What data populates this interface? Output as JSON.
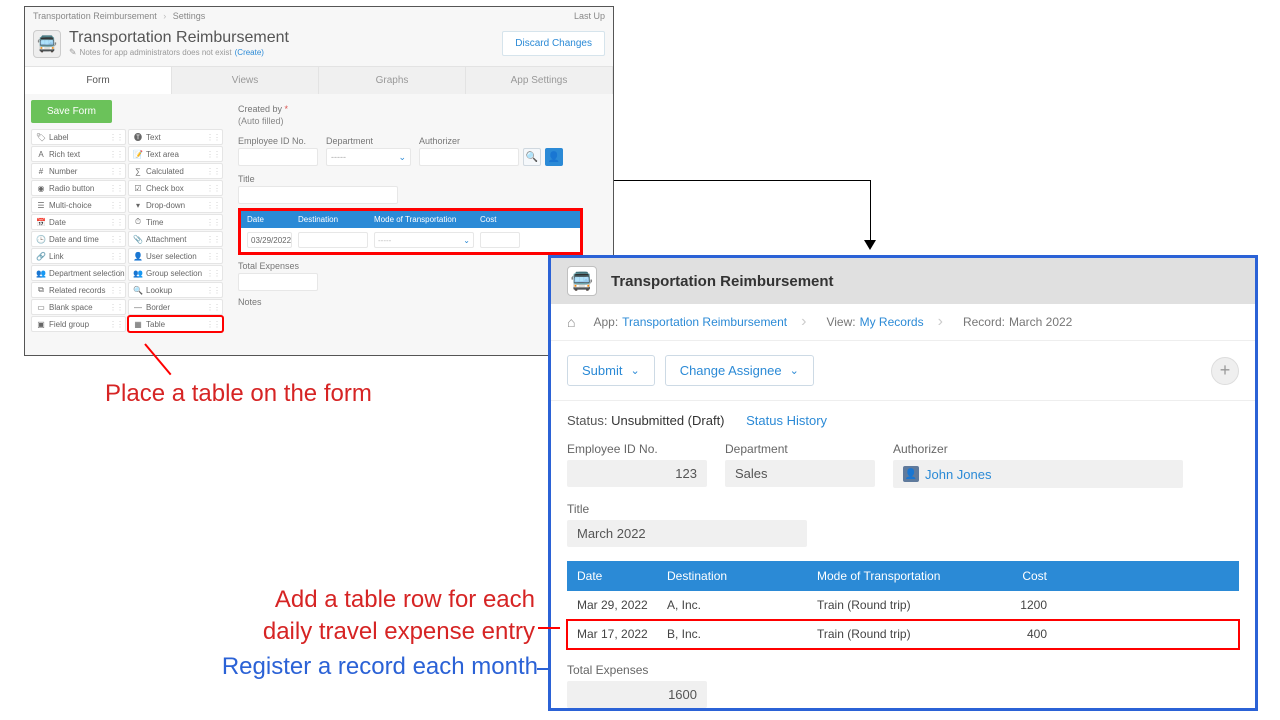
{
  "admin": {
    "breadcrumb": {
      "app": "Transportation Reimbursement",
      "page": "Settings",
      "lastup": "Last Up"
    },
    "title": "Transportation Reimbursement",
    "note_text": "Notes for app administrators does not exist",
    "note_link": "(Create)",
    "discard": "Discard Changes",
    "tabs": {
      "form": "Form",
      "views": "Views",
      "graphs": "Graphs",
      "app_settings": "App Settings"
    },
    "save": "Save Form",
    "fields_left": [
      "Label",
      "Rich text",
      "Number",
      "Radio button",
      "Multi-choice",
      "Date",
      "Date and time",
      "Link",
      "Department selection",
      "Related records",
      "Blank space",
      "Field group"
    ],
    "fields_right": [
      "Text",
      "Text area",
      "Calculated",
      "Check box",
      "Drop-down",
      "Time",
      "Attachment",
      "User selection",
      "Group selection",
      "Lookup",
      "Border",
      "Table"
    ],
    "form_labels": {
      "created_by": "Created by",
      "auto": "(Auto filled)",
      "emp": "Employee ID No.",
      "dept": "Department",
      "dept_ph": "-----",
      "auth": "Authorizer",
      "title": "Title",
      "total": "Total Expenses",
      "notes": "Notes"
    },
    "form_table": {
      "headers": [
        "Date",
        "Destination",
        "Mode of Transportation",
        "Cost"
      ],
      "row_date": "03/29/2022",
      "row_mode_ph": "-----"
    }
  },
  "record": {
    "title": "Transportation Reimbursement",
    "crumbs": {
      "app_label": "App:",
      "app_link": "Transportation Reimbursement",
      "view_label": "View:",
      "view_link": "My Records",
      "rec_label": "Record:",
      "rec_val": "March 2022"
    },
    "actions": {
      "submit": "Submit",
      "change": "Change Assignee"
    },
    "status_label": "Status:",
    "status_value": "Unsubmitted (Draft)",
    "status_history": "Status History",
    "labels": {
      "emp": "Employee ID No.",
      "dept": "Department",
      "auth": "Authorizer",
      "title": "Title",
      "total": "Total Expenses"
    },
    "values": {
      "emp": "123",
      "dept": "Sales",
      "auth": "John Jones",
      "title": "March 2022",
      "total": "1600"
    },
    "table": {
      "headers": [
        "Date",
        "Destination",
        "Mode of Transportation",
        "Cost"
      ],
      "rows": [
        {
          "date": "Mar 29, 2022",
          "dest": "A, Inc.",
          "mode": "Train (Round trip)",
          "cost": "1200"
        },
        {
          "date": "Mar 17, 2022",
          "dest": "B, Inc.",
          "mode": "Train (Round trip)",
          "cost": "400"
        }
      ]
    }
  },
  "callouts": {
    "c1": "Place a table on the form",
    "c2a": "Add a table row for each",
    "c2b": "daily travel expense entry",
    "c3": "Register a record each month"
  }
}
